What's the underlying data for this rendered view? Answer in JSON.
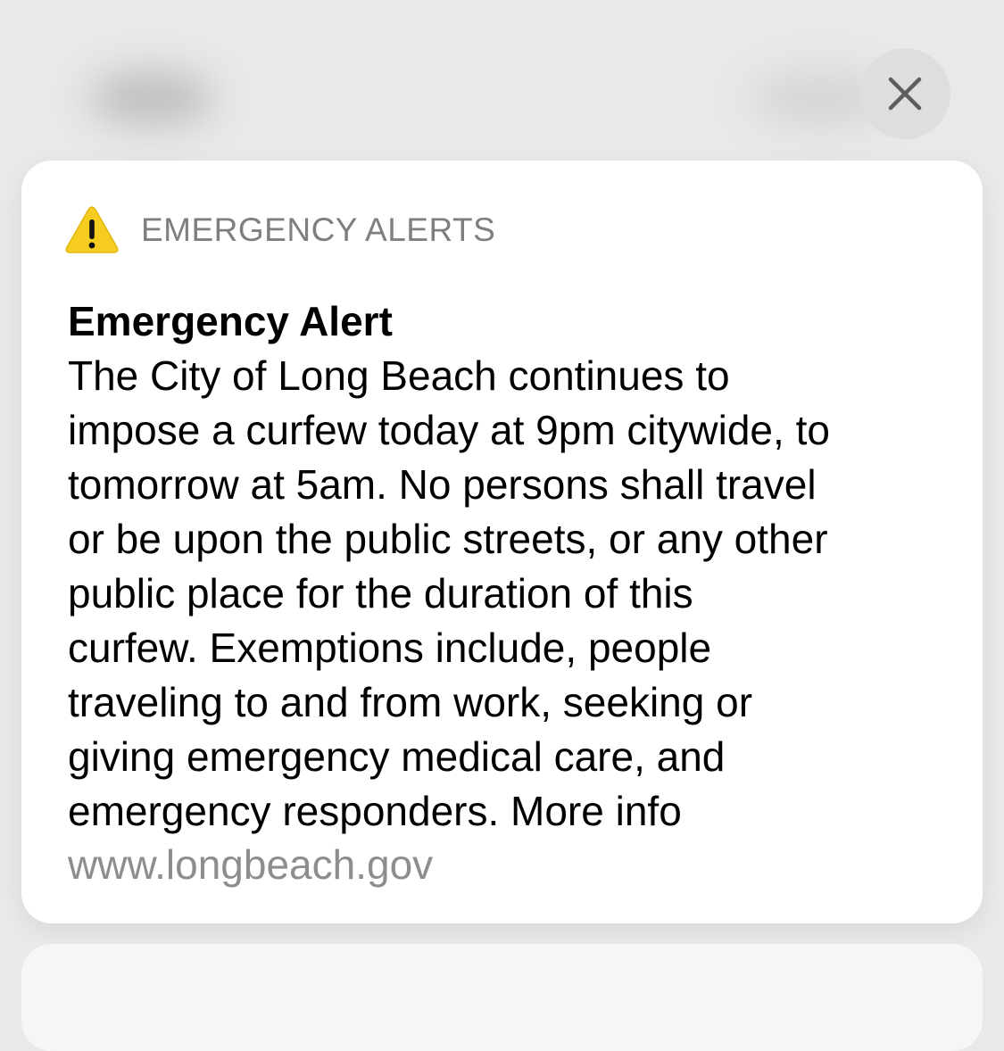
{
  "notification": {
    "app_name": "EMERGENCY ALERTS",
    "app_icon": "warning-triangle-icon",
    "title": "Emergency Alert",
    "body": "The City of Long Beach continues to\nimpose a curfew today at 9pm citywide, to\ntomorrow at 5am. No persons shall travel\nor be upon the public streets, or any other\npublic place for the duration of this\ncurfew. Exemptions include, people\ntraveling to and from work, seeking or\ngiving emergency medical care, and\nemergency responders. More info",
    "link": "www.longbeach.gov"
  },
  "controls": {
    "close_icon": "close-icon"
  },
  "colors": {
    "background": "#e9e9e9",
    "card": "#ffffff",
    "warning_yellow": "#f5cc1f",
    "secondary_text": "#7f7f7f",
    "link_text": "#8d8d8d"
  }
}
